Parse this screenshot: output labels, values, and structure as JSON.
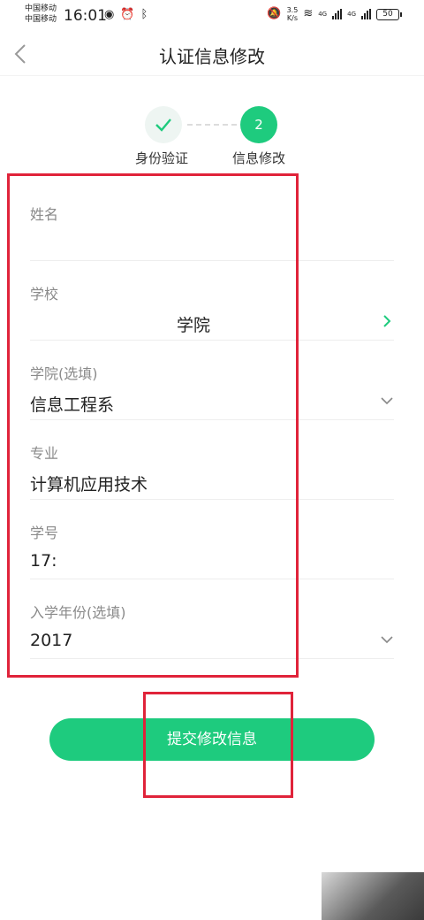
{
  "status_bar": {
    "carrier_line1": "中国移动",
    "carrier_line2": "中国移动",
    "time": "16:01",
    "net_speed_value": "3.5",
    "net_speed_unit": "K/s",
    "signal1_label": "4G",
    "signal2_label": "4G",
    "battery": "50"
  },
  "nav": {
    "title": "认证信息修改"
  },
  "stepper": {
    "step1_label": "身份验证",
    "step2_number": "2",
    "step2_label": "信息修改"
  },
  "form": {
    "name": {
      "label": "姓名",
      "value": ""
    },
    "school": {
      "label": "学校",
      "value": "学院"
    },
    "college": {
      "label": "学院(选填)",
      "value": "信息工程系"
    },
    "major": {
      "label": "专业",
      "value": "计算机应用技术"
    },
    "student_id": {
      "label": "学号",
      "value": "17:"
    },
    "enroll_year": {
      "label": "入学年份(选填)",
      "value": "2017"
    }
  },
  "submit": {
    "label": "提交修改信息"
  },
  "colors": {
    "accent": "#1ecb7e",
    "highlight": "#e0233a"
  }
}
